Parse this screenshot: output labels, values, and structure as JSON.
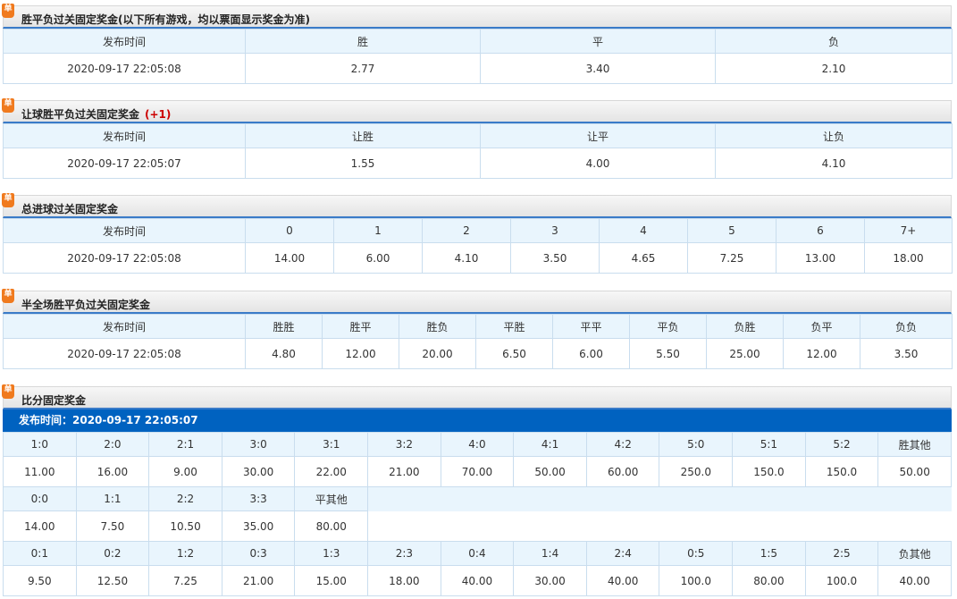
{
  "icon_label": "单",
  "wdl": {
    "title": "胜平负过关固定奖金(以下所有游戏，均以票面显示奖金为准)",
    "headers": [
      "发布时间",
      "胜",
      "平",
      "负"
    ],
    "row": [
      "2020-09-17 22:05:08",
      "2.77",
      "3.40",
      "2.10"
    ]
  },
  "handicap": {
    "title": "让球胜平负过关固定奖金",
    "handicap_value": "(+1)",
    "headers": [
      "发布时间",
      "让胜",
      "让平",
      "让负"
    ],
    "row": [
      "2020-09-17 22:05:07",
      "1.55",
      "4.00",
      "4.10"
    ]
  },
  "total_goals": {
    "title": "总进球过关固定奖金",
    "headers": [
      "发布时间",
      "0",
      "1",
      "2",
      "3",
      "4",
      "5",
      "6",
      "7+"
    ],
    "row": [
      "2020-09-17 22:05:08",
      "14.00",
      "6.00",
      "4.10",
      "3.50",
      "4.65",
      "7.25",
      "13.00",
      "18.00"
    ]
  },
  "half_full": {
    "title": "半全场胜平负过关固定奖金",
    "headers": [
      "发布时间",
      "胜胜",
      "胜平",
      "胜负",
      "平胜",
      "平平",
      "平负",
      "负胜",
      "负平",
      "负负"
    ],
    "row": [
      "2020-09-17 22:05:08",
      "4.80",
      "12.00",
      "20.00",
      "6.50",
      "6.00",
      "5.50",
      "25.00",
      "12.00",
      "3.50"
    ]
  },
  "score": {
    "title": "比分固定奖金",
    "publish_label": "发布时间：2020-09-17 22:05:07",
    "home_win": {
      "headers": [
        "1:0",
        "2:0",
        "2:1",
        "3:0",
        "3:1",
        "3:2",
        "4:0",
        "4:1",
        "4:2",
        "5:0",
        "5:1",
        "5:2",
        "胜其他"
      ],
      "values": [
        "11.00",
        "16.00",
        "9.00",
        "30.00",
        "22.00",
        "21.00",
        "70.00",
        "50.00",
        "60.00",
        "250.0",
        "150.0",
        "150.0",
        "50.00"
      ]
    },
    "draw": {
      "headers": [
        "0:0",
        "1:1",
        "2:2",
        "3:3",
        "平其他"
      ],
      "values": [
        "14.00",
        "7.50",
        "10.50",
        "35.00",
        "80.00"
      ]
    },
    "away_win": {
      "headers": [
        "0:1",
        "0:2",
        "1:2",
        "0:3",
        "1:3",
        "2:3",
        "0:4",
        "1:4",
        "2:4",
        "0:5",
        "1:5",
        "2:5",
        "负其他"
      ],
      "values": [
        "9.50",
        "12.50",
        "7.25",
        "21.00",
        "15.00",
        "18.00",
        "40.00",
        "30.00",
        "40.00",
        "100.0",
        "80.00",
        "100.0",
        "40.00"
      ]
    }
  }
}
